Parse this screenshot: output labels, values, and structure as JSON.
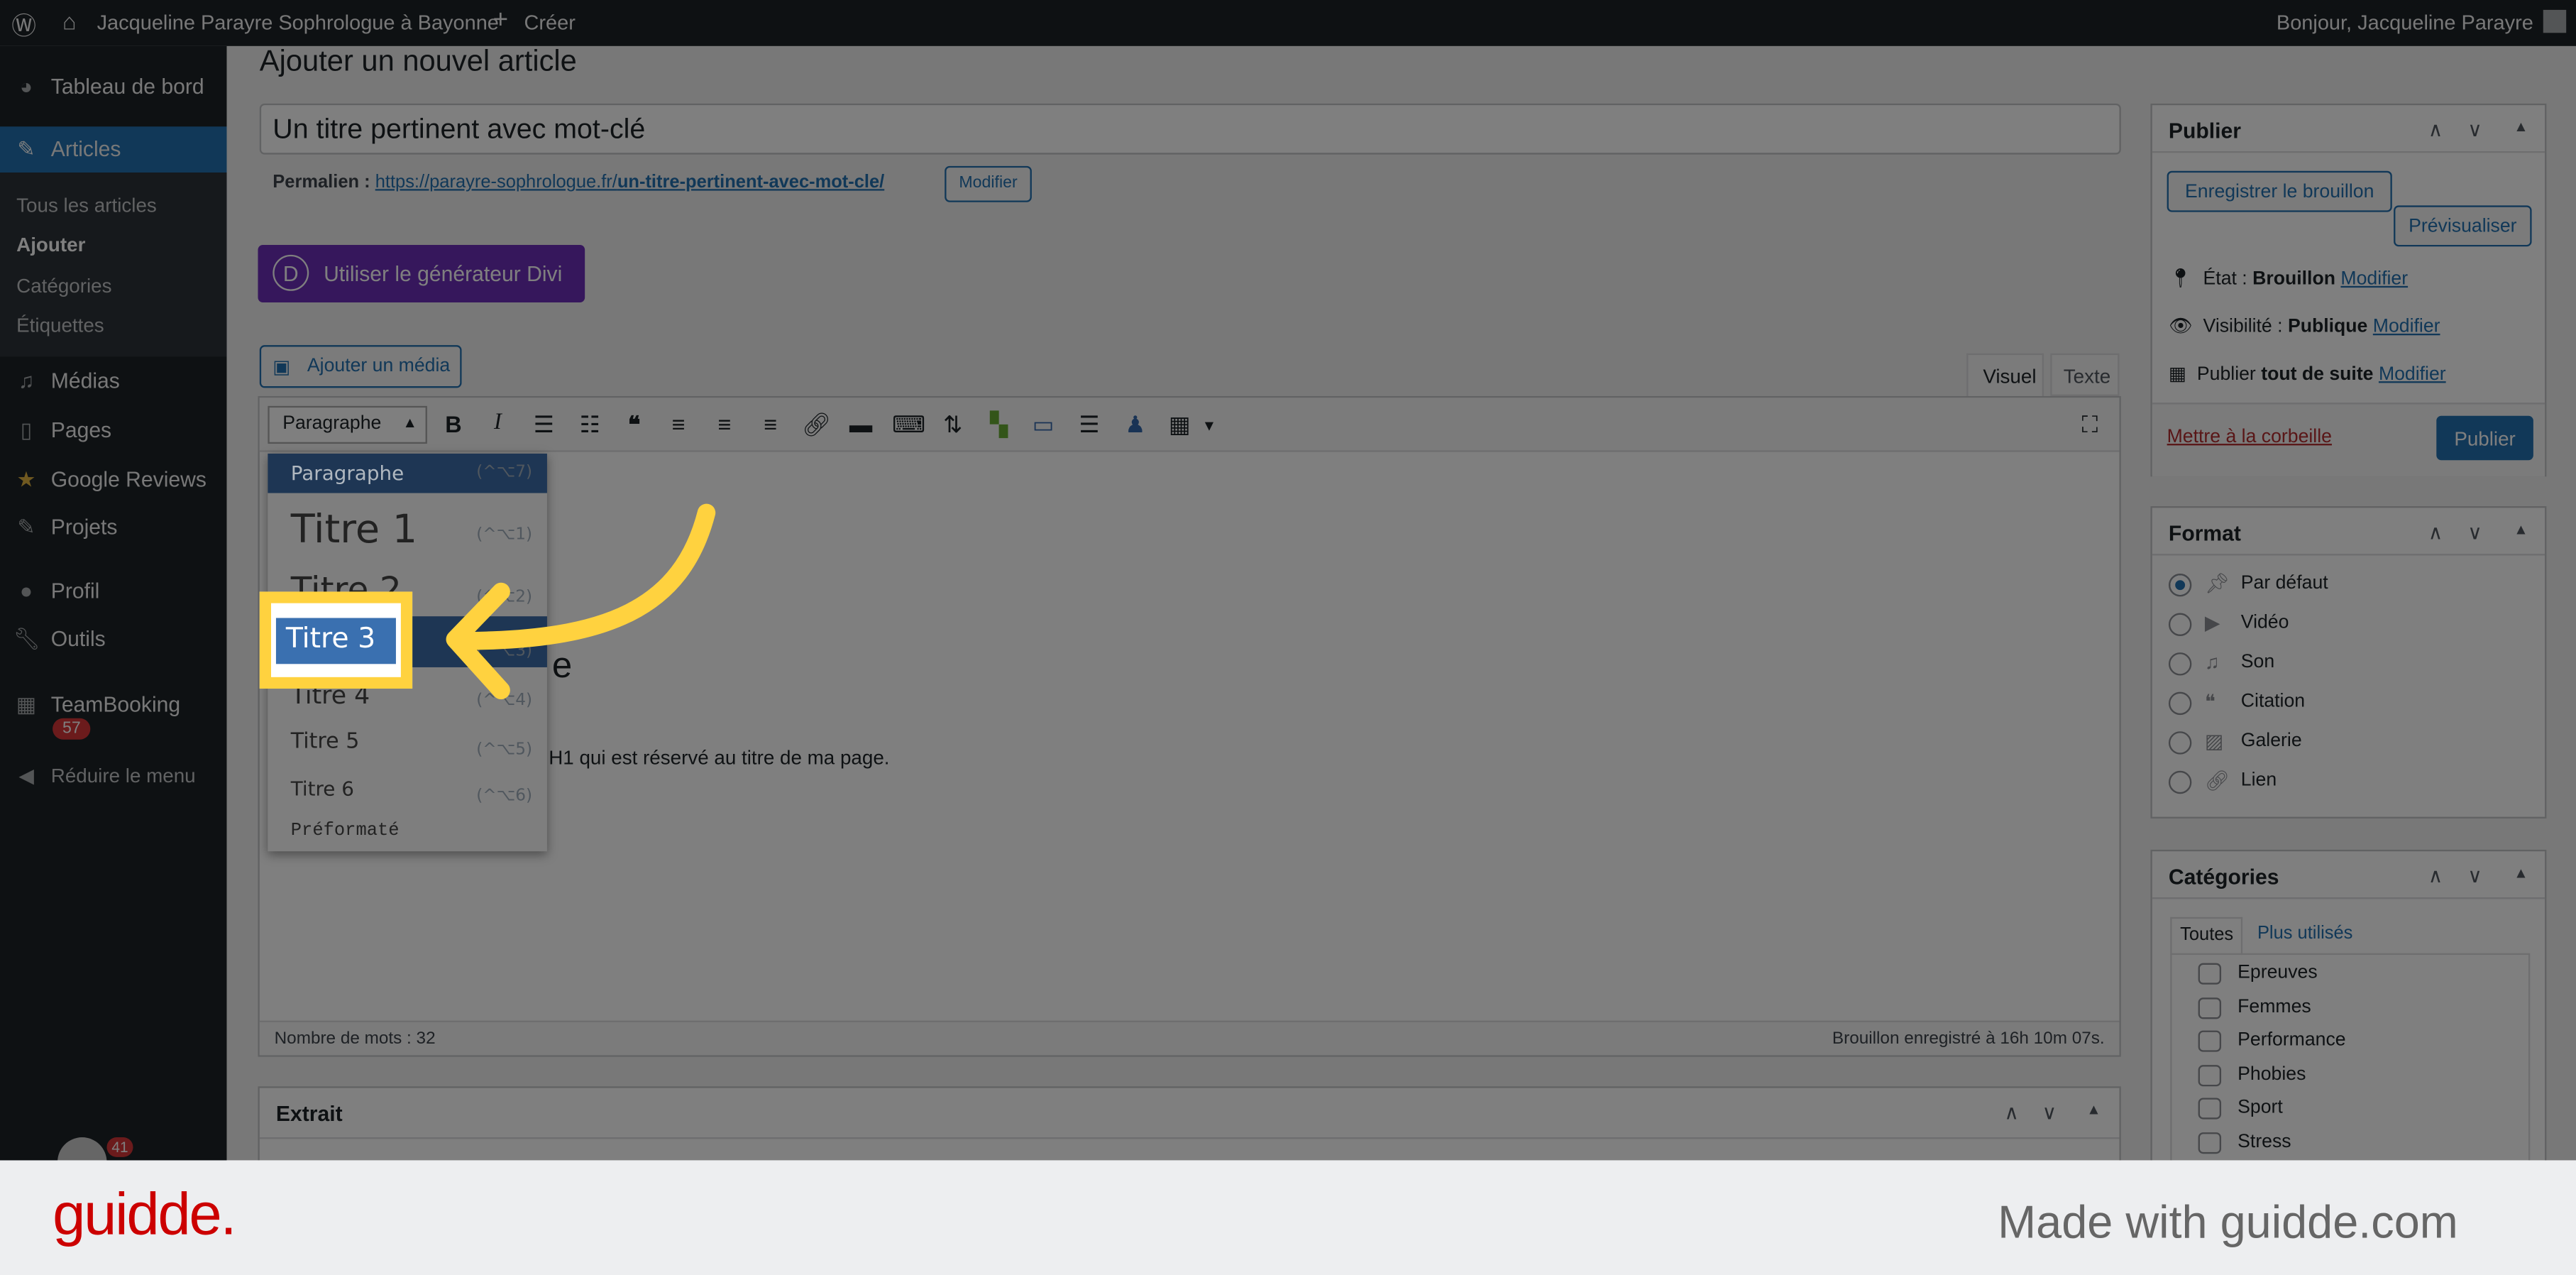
{
  "topbar": {
    "site": "Jacqueline Parayre Sophrologue à Bayonne",
    "create": "Créer",
    "greeting": "Bonjour, Jacqueline Parayre"
  },
  "sidebar": {
    "items": [
      {
        "label": "Tableau de bord",
        "icon": "dashboard-icon"
      },
      {
        "label": "Articles",
        "icon": "pin-icon"
      },
      {
        "label": "Médias",
        "icon": "media-icon"
      },
      {
        "label": "Pages",
        "icon": "pages-icon"
      },
      {
        "label": "Google Reviews",
        "icon": "star-icon"
      },
      {
        "label": "Projets",
        "icon": "pin-icon"
      },
      {
        "label": "Profil",
        "icon": "user-icon"
      },
      {
        "label": "Outils",
        "icon": "wrench-icon"
      },
      {
        "label": "TeamBooking",
        "icon": "calendar-icon",
        "badge": "57"
      },
      {
        "label": "Réduire le menu",
        "icon": "collapse-icon"
      }
    ],
    "subitems": [
      "Tous les articles",
      "Ajouter",
      "Catégories",
      "Étiquettes"
    ],
    "bottom_badge": "41"
  },
  "page": {
    "title": "Ajouter un nouvel article",
    "post_title": "Un titre pertinent avec mot-clé",
    "permalink_label": "Permalien :",
    "permalink_base": "https://parayre-sophrologue.fr/",
    "permalink_slug": "un-titre-pertinent-avec-mot-cle/",
    "permalink_edit": "Modifier",
    "divi": "Utiliser le générateur Divi",
    "divi_logo": "D",
    "add_media": "Ajouter un média"
  },
  "editor": {
    "tabs": [
      "Visuel",
      "Texte"
    ],
    "format_select": "Paragraphe",
    "heading_fragment": "e",
    "body_fragment": "H1 qui est réservé au titre de ma page.",
    "word_count": "Nombre de mots : 32",
    "saved": "Brouillon enregistré à 16h 10m 07s."
  },
  "format_menu": [
    {
      "label": "Paragraphe",
      "key": "(^⌥7)"
    },
    {
      "label": "Titre 1",
      "key": "(^⌥1)"
    },
    {
      "label": "Titre 2",
      "key": "(^⌥2)"
    },
    {
      "label": "Titre 3",
      "key": "(^⌥3)"
    },
    {
      "label": "Titre 4",
      "key": "(^⌥4)"
    },
    {
      "label": "Titre 5",
      "key": "(^⌥5)"
    },
    {
      "label": "Titre 6",
      "key": "(^⌥6)"
    },
    {
      "label": "Préformaté",
      "key": ""
    }
  ],
  "highlight": {
    "label": "Titre 3",
    "color": "#FFD23F"
  },
  "excerpt": {
    "title": "Extrait"
  },
  "publish": {
    "title": "Publier",
    "save_draft": "Enregistrer le brouillon",
    "preview": "Prévisualiser",
    "status_label": "État :",
    "status": "Brouillon",
    "visibility_label": "Visibilité :",
    "visibility": "Publique",
    "publish_label": "Publier",
    "publish_when": "tout de suite",
    "edit": "Modifier",
    "trash": "Mettre à la corbeille",
    "publish_btn": "Publier"
  },
  "format": {
    "title": "Format",
    "options": [
      "Par défaut",
      "Vidéo",
      "Son",
      "Citation",
      "Galerie",
      "Lien"
    ],
    "selected": 0
  },
  "categories": {
    "title": "Catégories",
    "tabs": [
      "Toutes",
      "Plus utilisés"
    ],
    "items": [
      "Epreuves",
      "Femmes",
      "Performance",
      "Phobies",
      "Sport",
      "Stress"
    ]
  },
  "footer": {
    "logo": "guidde.",
    "tagline": "Made with guidde.com",
    "brand_color": "#CC0000"
  }
}
